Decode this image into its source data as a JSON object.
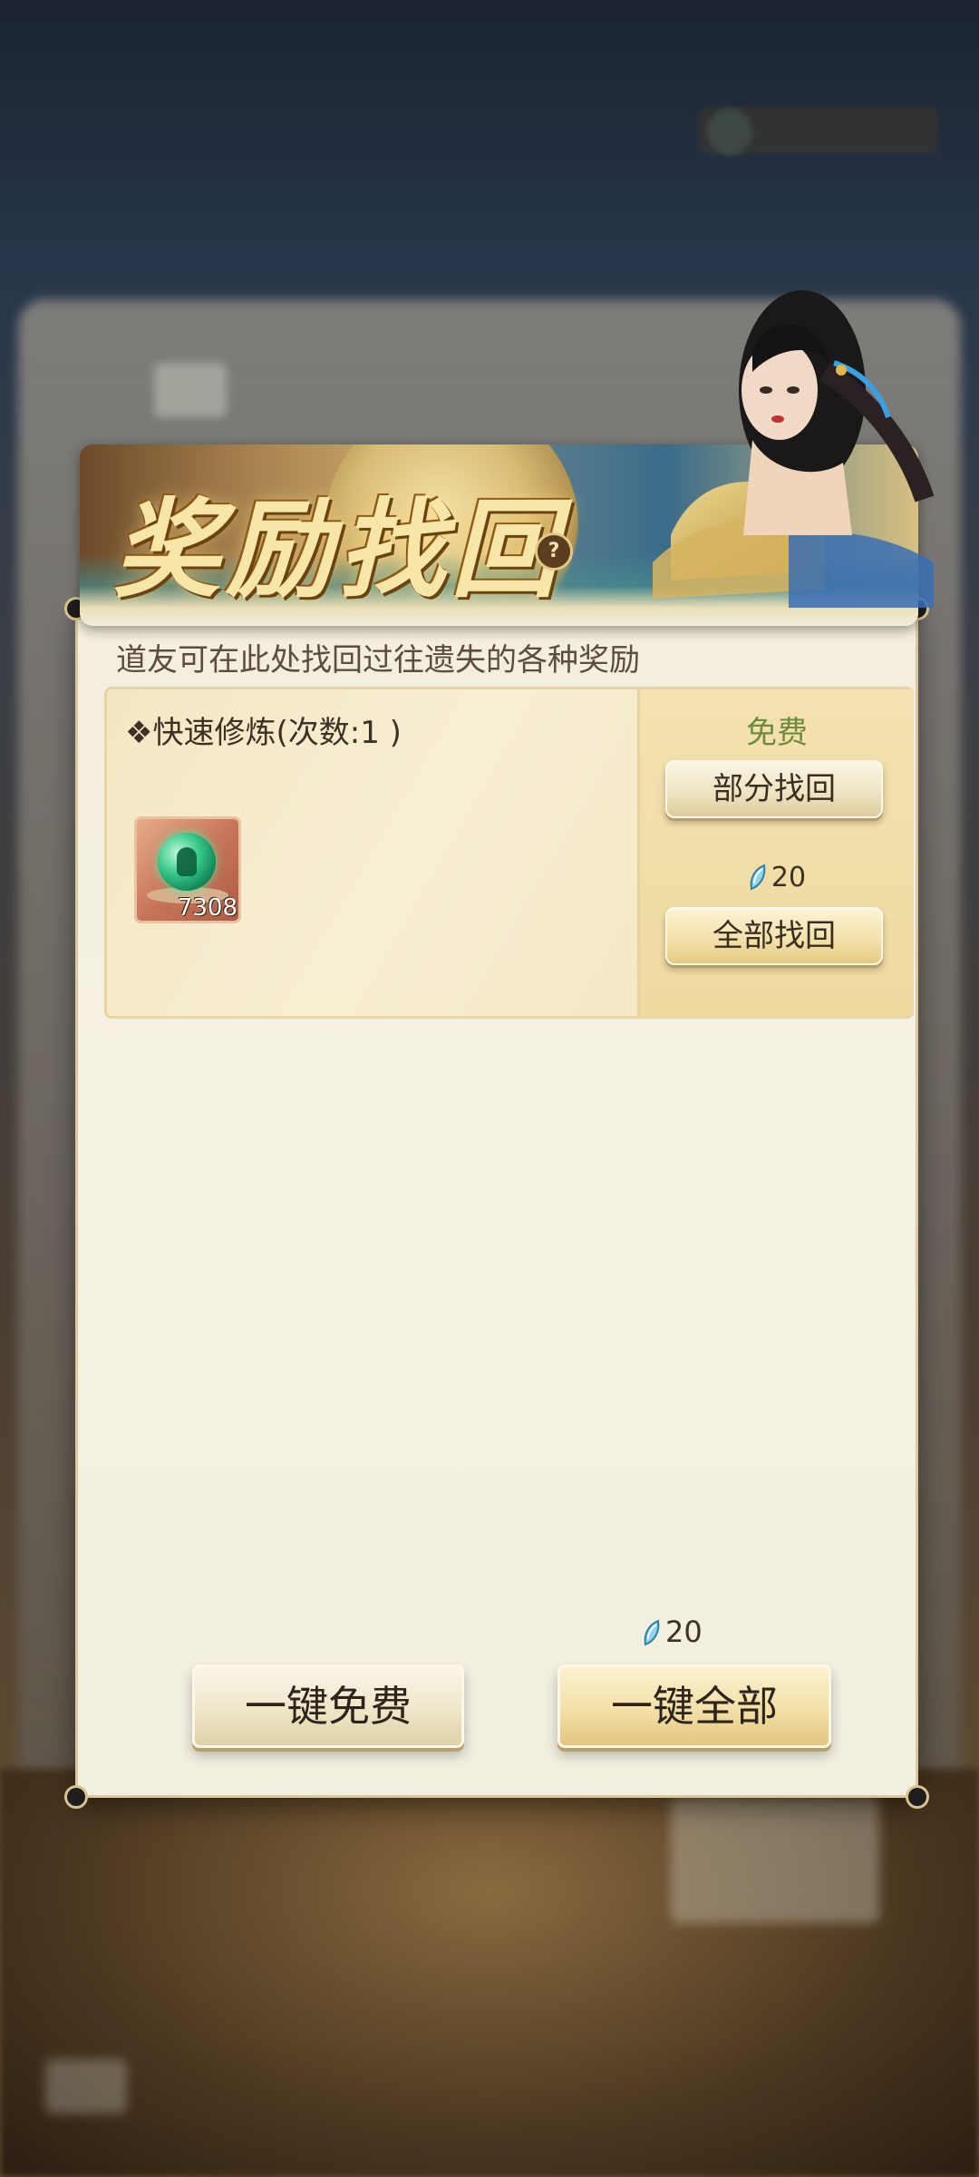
{
  "header": {
    "title": "奖励找回",
    "help_icon": "?",
    "subtitle": "道友可在此处找回过往遗失的各种奖励"
  },
  "reward_rows": [
    {
      "title": "❖快速修炼(次数:1 )",
      "item": {
        "icon": "jade-orb-icon",
        "quantity": "7308"
      },
      "free_label": "免费",
      "partial_button": "部分找回",
      "cost_icon": "jade-currency-icon",
      "cost": "20",
      "full_button": "全部找回"
    }
  ],
  "footer": {
    "cost_icon": "jade-currency-icon",
    "cost": "20",
    "one_key_free_button": "一键免费",
    "one_key_all_button": "一键全部"
  },
  "colors": {
    "free_text": "#6f8b3c",
    "title_gold": "#f7e6a8",
    "panel_bg": "#f3eedd"
  }
}
